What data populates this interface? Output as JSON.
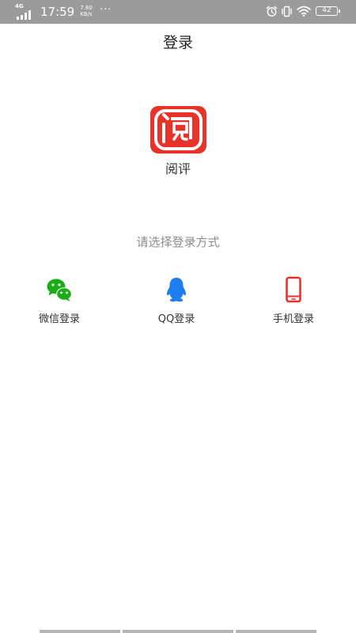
{
  "status_bar": {
    "network": "4G",
    "time": "17:59",
    "speed_value": "7.60",
    "speed_unit": "KB/s",
    "more": "···",
    "battery": "42"
  },
  "header": {
    "title": "登录"
  },
  "app": {
    "name": "阅评",
    "brand_color": "#e8332b"
  },
  "login": {
    "prompt": "请选择登录方式",
    "options": [
      {
        "label": "微信登录",
        "icon": "wechat-icon",
        "color": "#1aad19"
      },
      {
        "label": "QQ登录",
        "icon": "qq-icon",
        "color": "#1e7ef0"
      },
      {
        "label": "手机登录",
        "icon": "phone-icon",
        "color": "#e8332b"
      }
    ]
  }
}
